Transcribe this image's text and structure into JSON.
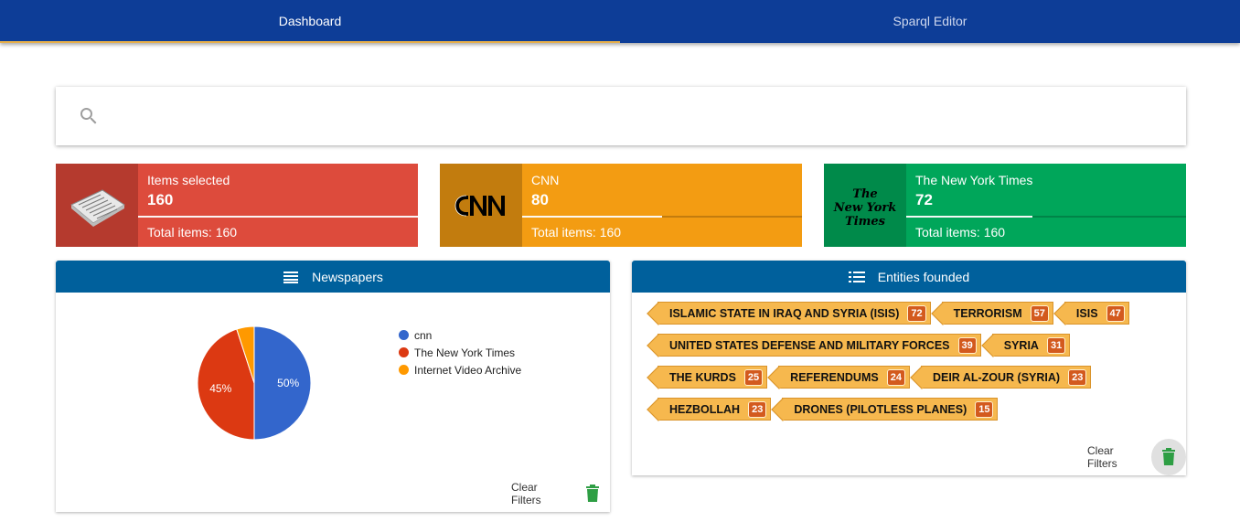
{
  "tabs": [
    {
      "label": "Dashboard",
      "active": true
    },
    {
      "label": "Sparql Editor",
      "active": false
    }
  ],
  "search": {
    "placeholder": "",
    "value": ""
  },
  "cards": [
    {
      "label": "Items selected",
      "value": "160",
      "total": "Total items: 160",
      "progress": 1.0,
      "icon": "newspaper-icon",
      "color": "#dd4b3c"
    },
    {
      "label": "CNN",
      "value": "80",
      "total": "Total items: 160",
      "progress": 0.5,
      "icon": "cnn-logo",
      "color": "#f39c12"
    },
    {
      "label": "The New York Times",
      "value": "72",
      "total": "Total items: 160",
      "progress": 0.45,
      "icon": "nyt-logo",
      "color": "#00a65a"
    }
  ],
  "newspapers_panel": {
    "title": "Newspapers",
    "icon": "list-lines-icon",
    "clear_label": "Clear Filters"
  },
  "entities_panel": {
    "title": "Entities founded",
    "icon": "list-bullets-icon",
    "clear_label": "Clear Filters",
    "rows": [
      [
        {
          "name": "ISLAMIC STATE IN IRAQ AND SYRIA (ISIS)",
          "count": "72"
        },
        {
          "name": "TERRORISM",
          "count": "57"
        },
        {
          "name": "ISIS",
          "count": "47"
        }
      ],
      [
        {
          "name": "UNITED STATES DEFENSE AND MILITARY FORCES",
          "count": "39"
        },
        {
          "name": "SYRIA",
          "count": "31"
        }
      ],
      [
        {
          "name": "THE KURDS",
          "count": "25"
        },
        {
          "name": "REFERENDUMS",
          "count": "24"
        },
        {
          "name": "DEIR AL-ZOUR (SYRIA)",
          "count": "23"
        }
      ],
      [
        {
          "name": "HEZBOLLAH",
          "count": "23"
        },
        {
          "name": "DRONES (PILOTLESS PLANES)",
          "count": "15"
        }
      ]
    ]
  },
  "chart_data": {
    "type": "pie",
    "title": "",
    "series": [
      {
        "name": "cnn",
        "value": 80,
        "label": "50%",
        "color": "#3366cc"
      },
      {
        "name": "The New York Times",
        "value": 72,
        "label": "45%",
        "color": "#dc3912"
      },
      {
        "name": "Internet Video Archive",
        "value": 8,
        "label": "",
        "color": "#ff9900"
      }
    ],
    "legend": "right"
  }
}
